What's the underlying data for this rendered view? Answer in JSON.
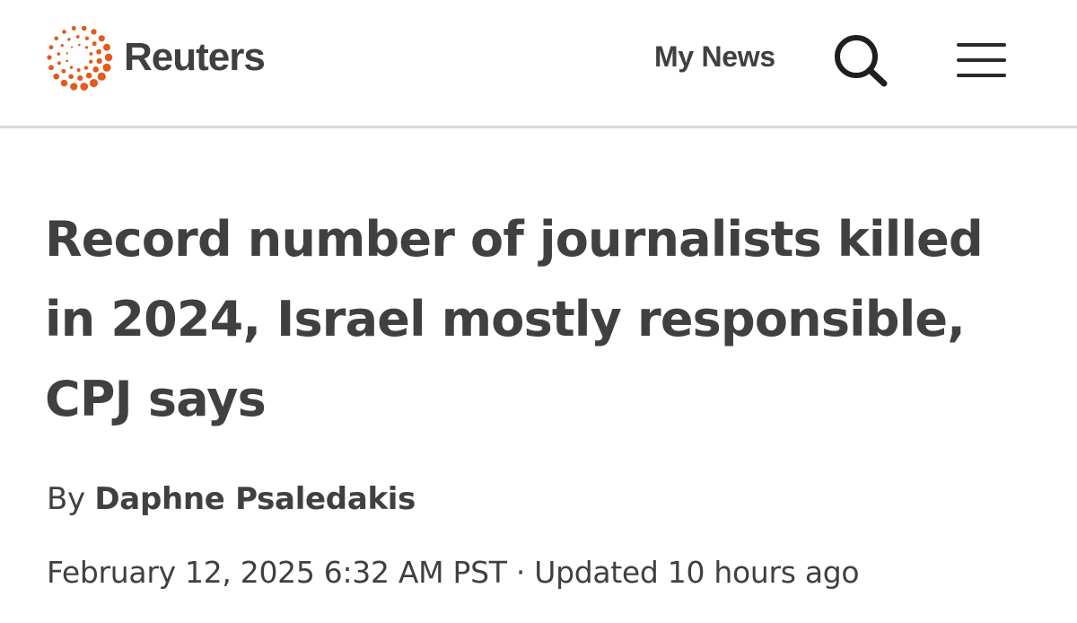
{
  "header": {
    "logo_text": "Reuters",
    "my_news_label": "My News",
    "search_icon": "search-icon",
    "menu_icon": "hamburger-menu-icon"
  },
  "article": {
    "headline": "Record number of journalists killed in 2024, Israel mostly responsible, CPJ says",
    "byline_prefix": "By",
    "author": "Daphne Psaledakis",
    "published": "February 12, 2025 6:32 AM PST",
    "separator": "·",
    "updated": "Updated 10 hours ago"
  },
  "colors": {
    "brand_orange": "#e35a1b",
    "text": "#404040",
    "divider": "#d9d9d9"
  }
}
